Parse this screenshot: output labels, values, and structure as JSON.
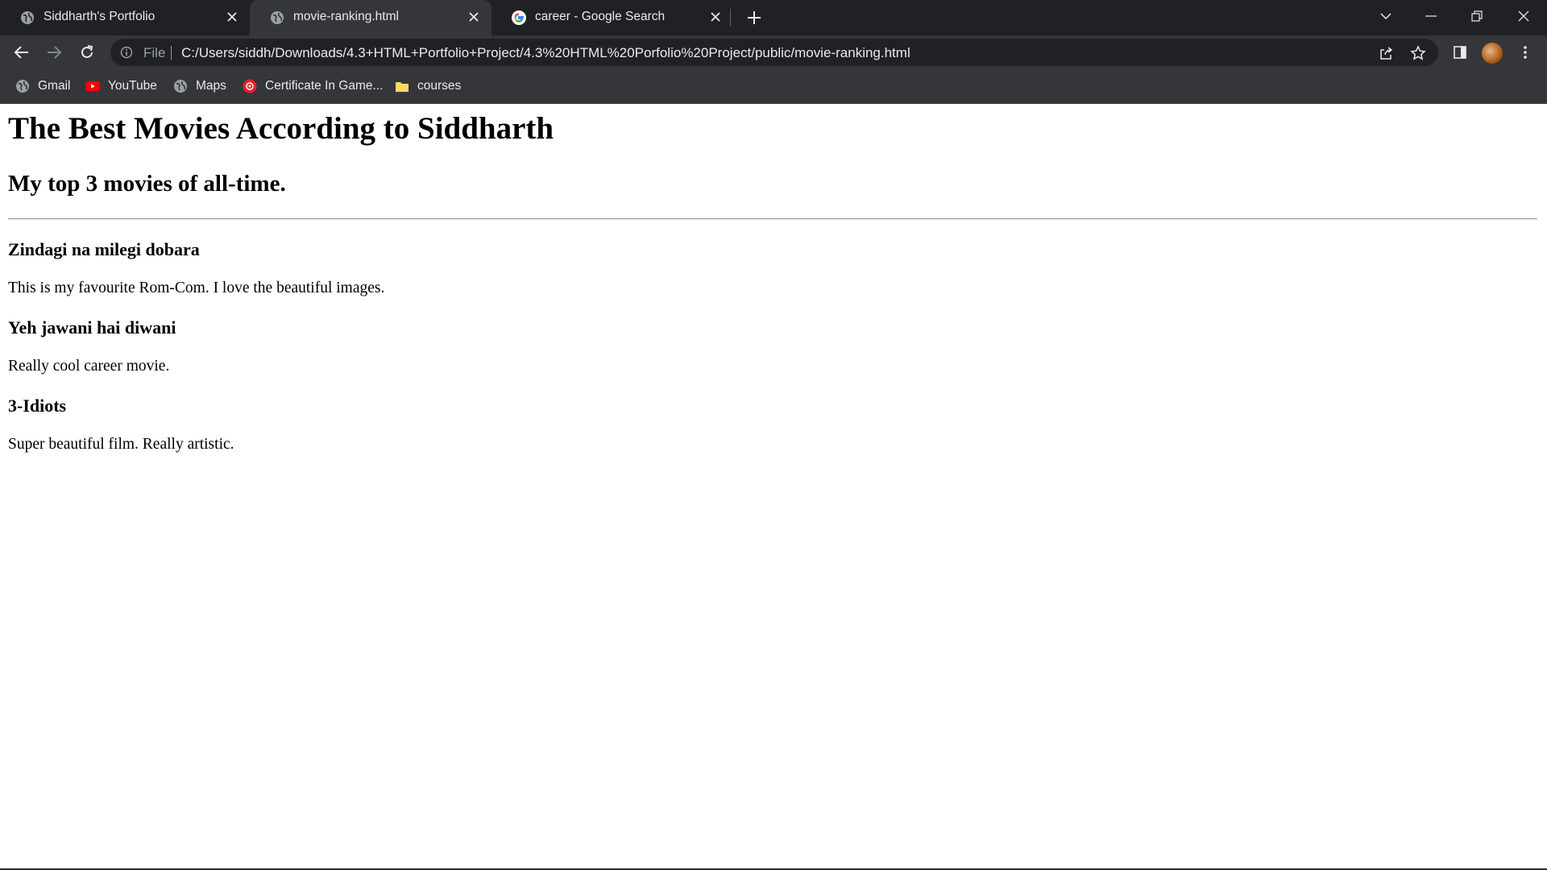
{
  "browser": {
    "tabs": [
      {
        "title": "Siddharth's Portfolio",
        "icon": "globe-icon",
        "active": false
      },
      {
        "title": "movie-ranking.html",
        "icon": "globe-icon",
        "active": true
      },
      {
        "title": "career - Google Search",
        "icon": "google-icon",
        "active": false
      }
    ],
    "address": {
      "scheme": "File",
      "url": "C:/Users/siddh/Downloads/4.3+HTML+Portfolio+Project/4.3%20HTML%20Porfolio%20Project/public/movie-ranking.html"
    },
    "bookmarks": [
      {
        "label": "Gmail",
        "icon": "globe-icon"
      },
      {
        "label": "YouTube",
        "icon": "youtube-icon"
      },
      {
        "label": "Maps",
        "icon": "globe-icon"
      },
      {
        "label": "Certificate In Game...",
        "icon": "red-badge-icon"
      },
      {
        "label": "courses",
        "icon": "folder-icon"
      }
    ],
    "colors": {
      "tabstrip": "#202124",
      "toolbar": "#35363a",
      "text": "#e8eaed"
    }
  },
  "page": {
    "heading": "The Best Movies According to Siddharth",
    "subheading": "My top 3 movies of all-time.",
    "movies": [
      {
        "title": "Zindagi na milegi dobara",
        "description": "This is my favourite Rom-Com. I love the beautiful images."
      },
      {
        "title": "Yeh jawani hai diwani",
        "description": "Really cool career movie."
      },
      {
        "title": "3-Idiots",
        "description": "Super beautiful film. Really artistic."
      }
    ]
  }
}
